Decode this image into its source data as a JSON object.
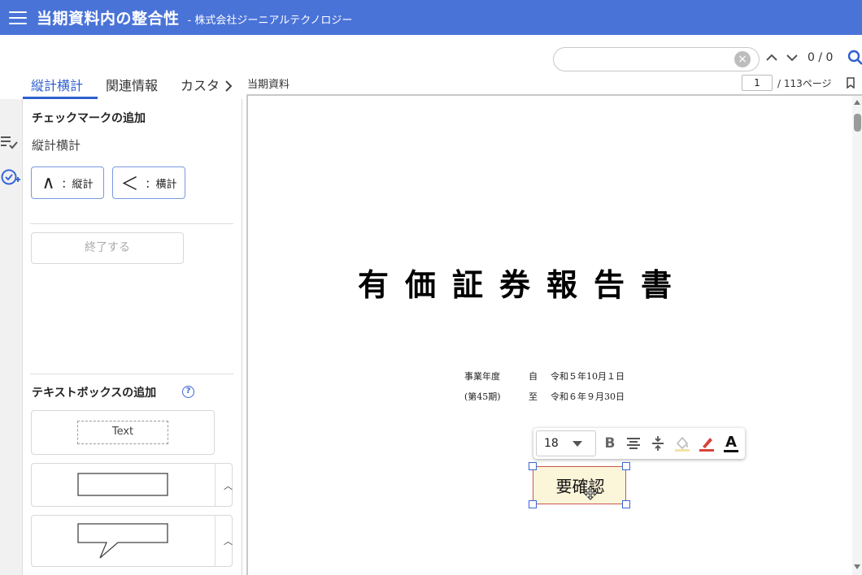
{
  "header": {
    "title": "当期資料内の整合性",
    "company": "- 株式会社ジーニアルテクノロジー"
  },
  "search": {
    "value": "",
    "count": "0 / 0"
  },
  "tabs": [
    {
      "label": "縦計横計"
    },
    {
      "label": "関連情報"
    },
    {
      "label": "カスタ"
    }
  ],
  "panel": {
    "checkmark_title": "チェックマークの追加",
    "checkmark_sub": "縦計横計",
    "vertical_glyph": "∧",
    "vertical_label": "：縦計",
    "horizontal_glyph": "＜",
    "horizontal_label": "：横計",
    "finish_label": "終了する",
    "textbox_title": "テキストボックスの追加",
    "text_sample": "Text"
  },
  "viewer": {
    "label": "当期資料",
    "page_current": "1",
    "page_total": "/ 113ページ"
  },
  "document": {
    "title": "有価証券報告書",
    "fiscal_label": "事業年度",
    "period_label": "(第45期)",
    "from_label": "自",
    "from_date": "令和５年10月１日",
    "to_label": "至",
    "to_date": "令和６年９月30日"
  },
  "toolbar": {
    "font_size": "18",
    "bold": "B",
    "text_color": "A"
  },
  "annotation": {
    "text": "要確認"
  },
  "colors": {
    "header": "#4a73d8",
    "accent": "#2f5fd0",
    "annotation_fill": "#fbf5d9",
    "annotation_border": "#c9574f",
    "pen": "#d9443a"
  }
}
